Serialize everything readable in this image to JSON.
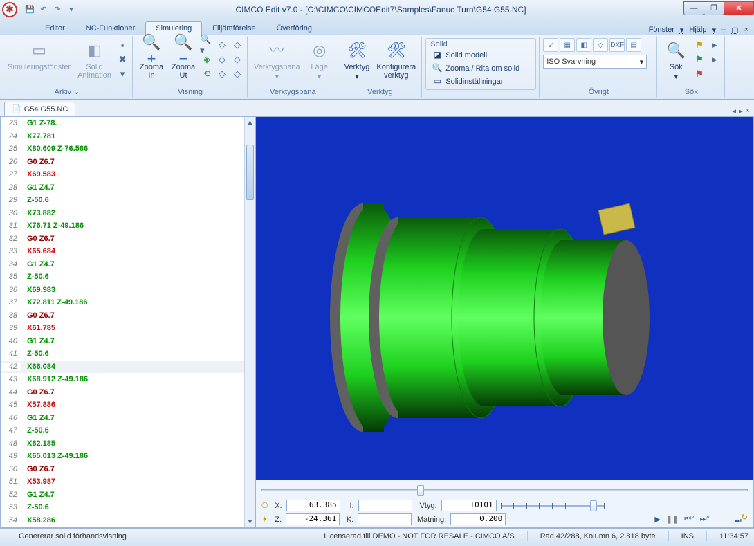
{
  "title": "CIMCO Edit v7.0 - [C:\\CIMCO\\CIMCOEdit7\\Samples\\Fanuc Turn\\G54 G55.NC]",
  "qat": {
    "save": "💾",
    "undo": "↶",
    "redo": "↷",
    "more": "▾"
  },
  "tabs": [
    "Editor",
    "NC-Funktioner",
    "Simulering",
    "Filjämförelse",
    "Överföring"
  ],
  "active_tab": 2,
  "header_right": {
    "fenster": "Fönster",
    "hjalp": "Hjälp"
  },
  "groups": {
    "arkiv": {
      "label": "Arkiv",
      "b1": "Simuleringsfönster",
      "b2": "Solid\nAnimation"
    },
    "visning": {
      "label": "Visning",
      "zoom_in": "Zooma\nIn",
      "zoom_out": "Zooma\nUt"
    },
    "verktygsbana": {
      "label": "Verktygsbana",
      "b1": "Verktygsbana",
      "b2": "Läge"
    },
    "verktyg": {
      "label": "Verktyg",
      "b1": "Verktyg",
      "b2": "Konfigurera\nverktyg"
    },
    "solid": {
      "hdr": "Solid",
      "b1": "Solid modell",
      "b2": "Zooma / Rita om solid",
      "b3": "Solidinställningar"
    },
    "ovrigt": {
      "label": "Övrigt",
      "combo": "ISO Svarvning"
    },
    "sok": {
      "label": "Sök",
      "b1": "Sök"
    }
  },
  "doctab": "G54 G55.NC",
  "code": [
    {
      "n": 23,
      "cls": "t-green",
      "t": "G1 Z-78."
    },
    {
      "n": 24,
      "cls": "t-green",
      "t": "X77.781"
    },
    {
      "n": 25,
      "cls": "t-green",
      "t": "X80.609 Z-76.586"
    },
    {
      "n": 26,
      "cls": "t-darkred",
      "t": "G0 Z6.7"
    },
    {
      "n": 27,
      "cls": "t-red",
      "t": "X69.583"
    },
    {
      "n": 28,
      "cls": "t-green",
      "t": "G1 Z4.7"
    },
    {
      "n": 29,
      "cls": "t-green",
      "t": "Z-50.6"
    },
    {
      "n": 30,
      "cls": "t-green",
      "t": "X73.882"
    },
    {
      "n": 31,
      "cls": "t-green",
      "t": "X76.71 Z-49.186"
    },
    {
      "n": 32,
      "cls": "t-darkred",
      "t": "G0 Z6.7"
    },
    {
      "n": 33,
      "cls": "t-red",
      "t": "X65.684"
    },
    {
      "n": 34,
      "cls": "t-green",
      "t": "G1 Z4.7"
    },
    {
      "n": 35,
      "cls": "t-green",
      "t": "Z-50.6"
    },
    {
      "n": 36,
      "cls": "t-green",
      "t": "X69.983"
    },
    {
      "n": 37,
      "cls": "t-green",
      "t": "X72.811 Z-49.186"
    },
    {
      "n": 38,
      "cls": "t-darkred",
      "t": "G0 Z6.7"
    },
    {
      "n": 39,
      "cls": "t-red",
      "t": "X61.785"
    },
    {
      "n": 40,
      "cls": "t-green",
      "t": "G1 Z4.7"
    },
    {
      "n": 41,
      "cls": "t-green",
      "t": "Z-50.6"
    },
    {
      "n": 42,
      "cls": "t-green",
      "t": "X66.084",
      "hl": true
    },
    {
      "n": 43,
      "cls": "t-green",
      "t": "X68.912 Z-49.186"
    },
    {
      "n": 44,
      "cls": "t-darkred",
      "t": "G0 Z6.7"
    },
    {
      "n": 45,
      "cls": "t-red",
      "t": "X57.886"
    },
    {
      "n": 46,
      "cls": "t-green",
      "t": "G1 Z4.7"
    },
    {
      "n": 47,
      "cls": "t-green",
      "t": "Z-50.6"
    },
    {
      "n": 48,
      "cls": "t-green",
      "t": "X62.185"
    },
    {
      "n": 49,
      "cls": "t-green",
      "t": "X65.013 Z-49.186"
    },
    {
      "n": 50,
      "cls": "t-darkred",
      "t": "G0 Z6.7"
    },
    {
      "n": 51,
      "cls": "t-red",
      "t": "X53.987"
    },
    {
      "n": 52,
      "cls": "t-green",
      "t": "G1 Z4.7"
    },
    {
      "n": 53,
      "cls": "t-green",
      "t": "Z-50.6"
    },
    {
      "n": 54,
      "cls": "t-green",
      "t": "X58.286"
    }
  ],
  "readout": {
    "x_lbl": "X:",
    "x": "63.385",
    "z_lbl": "Z:",
    "z": "-24.361",
    "i_lbl": "I:",
    "i": "",
    "k_lbl": "K:",
    "k": "",
    "vtyg_lbl": "Vtyg:",
    "vtyg": "T0101",
    "matning_lbl": "Matning:",
    "matning": "0.200"
  },
  "status": {
    "msg": "Genererar solid förhandsvisning",
    "license": "Licenserad till DEMO - NOT FOR RESALE - CIMCO A/S",
    "pos": "Rad 42/288, Kolumn 6, 2.818 byte",
    "ins": "INS",
    "time": "11:34:57"
  }
}
